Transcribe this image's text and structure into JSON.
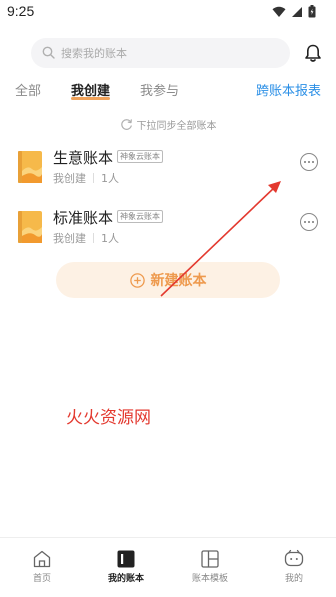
{
  "status_bar": {
    "time": "9:25",
    "icons": [
      "wifi-icon",
      "signal-icon",
      "battery-icon"
    ]
  },
  "search": {
    "placeholder": "搜索我的账本"
  },
  "tabs": {
    "all": "全部",
    "created": "我创建",
    "joined": "我参与",
    "cross_report": "跨账本报表"
  },
  "sync_hint": "下拉同步全部账本",
  "books": [
    {
      "name": "生意账本",
      "badge": "神象云账本",
      "owner": "我创建",
      "members": "1人"
    },
    {
      "name": "标准账本",
      "badge": "神象云账本",
      "owner": "我创建",
      "members": "1人"
    }
  ],
  "new_book_label": "新建账本",
  "watermark": "火火资源网",
  "bottom_nav": [
    {
      "label": "首页",
      "icon": "home-icon",
      "active": false
    },
    {
      "label": "我的账本",
      "icon": "ledger-icon",
      "active": true
    },
    {
      "label": "账本模板",
      "icon": "template-icon",
      "active": false
    },
    {
      "label": "我的",
      "icon": "profile-icon",
      "active": false
    }
  ],
  "colors": {
    "accent": "#ee9a4e",
    "tab_underline": "#f0a25a",
    "link_blue": "#2b8fe6",
    "new_book_bg": "#fdf1e4",
    "watermark_red": "#e3392f"
  }
}
